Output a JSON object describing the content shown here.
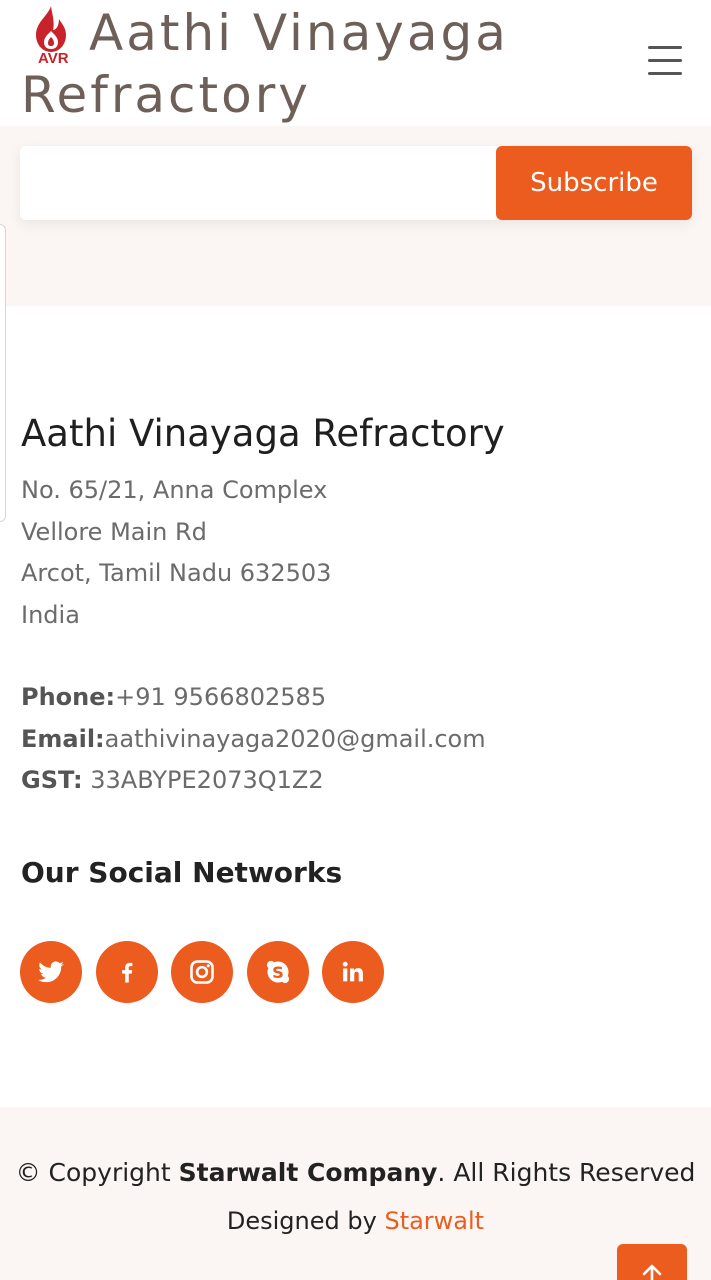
{
  "header": {
    "logo_text": "AVR",
    "brand_name": "Aathi Vinayaga Refractory",
    "menu_icon": "hamburger-icon"
  },
  "newsletter": {
    "email_value": "",
    "subscribe_label": "Subscribe"
  },
  "contact": {
    "company_name": "Aathi Vinayaga Refractory",
    "address_lines": [
      "No. 65/21, Anna Complex",
      "Vellore Main Rd",
      "Arcot, Tamil Nadu 632503",
      "India"
    ],
    "phone_label": "Phone:",
    "phone_value": "+91 9566802585",
    "email_label": "Email:",
    "email_value": "aathivinayaga2020@gmail.com",
    "gst_label": "GST:",
    "gst_value": " 33ABYPE2073Q1Z2"
  },
  "social": {
    "heading": "Our Social Networks",
    "networks": [
      "twitter-icon",
      "facebook-icon",
      "instagram-icon",
      "skype-icon",
      "linkedin-icon"
    ]
  },
  "footer": {
    "copyright_prefix": "© Copyright ",
    "copyright_company": "Starwalt Company",
    "copyright_suffix": ". All Rights Reserved",
    "designed_prefix": "Designed by ",
    "designed_link": "Starwalt",
    "back_to_top_icon": "arrow-up-icon"
  },
  "colors": {
    "accent": "#ec5c1e",
    "logo_red": "#c8222a",
    "band_background": "#fbf6f3",
    "brand_text": "#6e6058"
  }
}
